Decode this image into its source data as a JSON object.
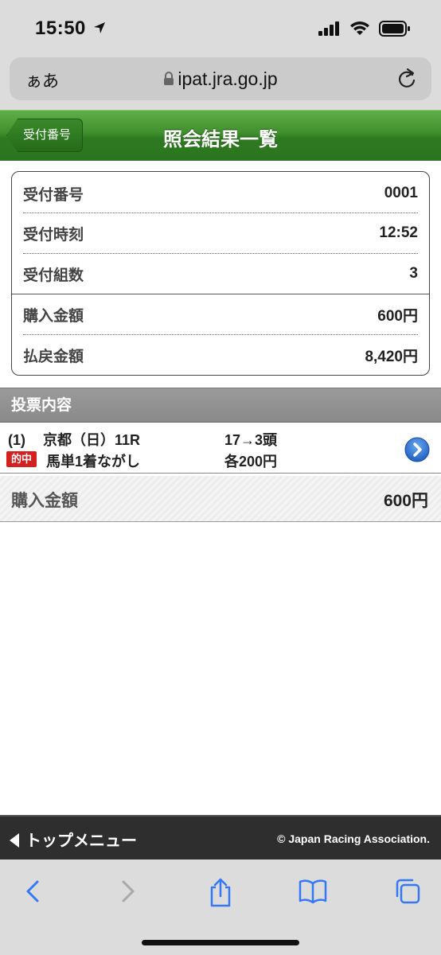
{
  "status_bar": {
    "time": "15:50",
    "icons": [
      "location-arrow-icon",
      "signal-icon",
      "wifi-icon",
      "battery-icon"
    ]
  },
  "address_bar": {
    "text_size_label": "ぁあ",
    "url": "ipat.jra.go.jp"
  },
  "header": {
    "back_label": "受付番号",
    "title": "照会結果一覧",
    "color": "#3f8f2d"
  },
  "receipt": {
    "rows": [
      {
        "label": "受付番号",
        "value": "0001"
      },
      {
        "label": "受付時刻",
        "value": "12:52"
      },
      {
        "label": "受付組数",
        "value": "3"
      },
      {
        "label": "購入金額",
        "value": "600円"
      },
      {
        "label": "払戻金額",
        "value": "8,420円"
      }
    ]
  },
  "section": {
    "title": "投票内容"
  },
  "bet": {
    "number": "(1)",
    "race": "京都（日）11R",
    "combination": "17→3頭",
    "hit_badge": "的中",
    "bet_type": "馬単1着ながし",
    "amount": "各200円",
    "hit_color": "#d42020"
  },
  "total": {
    "label": "購入金額",
    "value": "600円"
  },
  "footer": {
    "top_menu": "トップメニュー",
    "copyright": "© Japan Racing Association."
  },
  "safari_toolbar": {
    "icons": [
      "back-icon",
      "forward-icon",
      "share-icon",
      "bookmarks-icon",
      "tabs-icon"
    ],
    "accent": "#3478f6"
  }
}
